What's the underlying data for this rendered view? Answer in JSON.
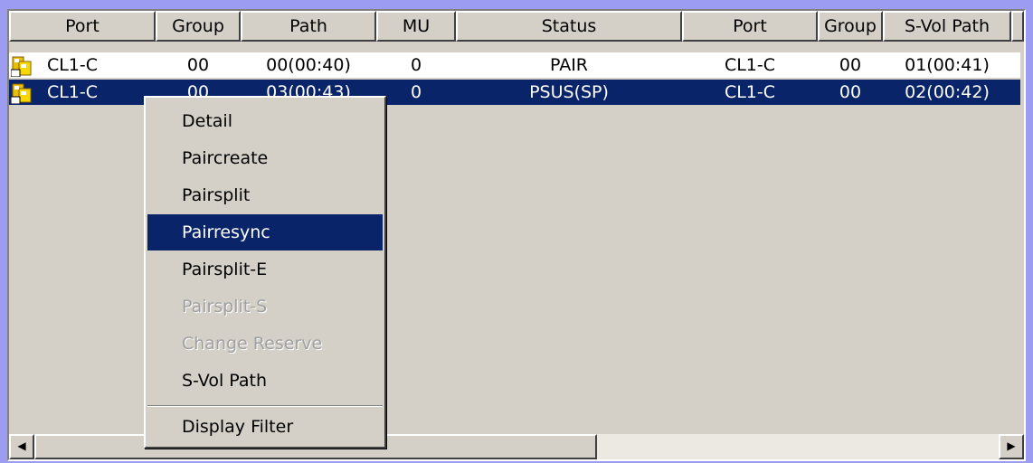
{
  "columns": [
    "Port",
    "Group",
    "Path",
    "MU",
    "Status",
    "Port",
    "Group",
    "S-Vol Path"
  ],
  "rows": [
    {
      "icon": "pair-volume-icon",
      "port": "CL1-C",
      "group": "00",
      "path": "00(00:40)",
      "mu": "0",
      "status": "PAIR",
      "s_port": "CL1-C",
      "s_group": "00",
      "s_path": "01(00:41)",
      "selected": false
    },
    {
      "icon": "pair-volume-icon",
      "port": "CL1-C",
      "group": "00",
      "path": "03(00:43)",
      "mu": "0",
      "status": "PSUS(SP)",
      "s_port": "CL1-C",
      "s_group": "00",
      "s_path": "02(00:42)",
      "selected": true
    }
  ],
  "context_menu": {
    "items": [
      {
        "label": "Detail",
        "enabled": true,
        "highlighted": false
      },
      {
        "label": "Paircreate",
        "enabled": true,
        "highlighted": false
      },
      {
        "label": "Pairsplit",
        "enabled": true,
        "highlighted": false
      },
      {
        "label": "Pairresync",
        "enabled": true,
        "highlighted": true
      },
      {
        "label": "Pairsplit-E",
        "enabled": true,
        "highlighted": false
      },
      {
        "label": "Pairsplit-S",
        "enabled": false,
        "highlighted": false
      },
      {
        "label": "Change Reserve",
        "enabled": false,
        "highlighted": false
      },
      {
        "label": "S-Vol Path",
        "enabled": true,
        "highlighted": false
      },
      {
        "label": "Display Filter",
        "enabled": true,
        "highlighted": false
      }
    ]
  },
  "scrollbar": {
    "left_arrow": "◀",
    "right_arrow": "▶"
  },
  "colors": {
    "selection": "#0a246a",
    "background": "#d4d0c8",
    "border": "#9c9cf2"
  }
}
